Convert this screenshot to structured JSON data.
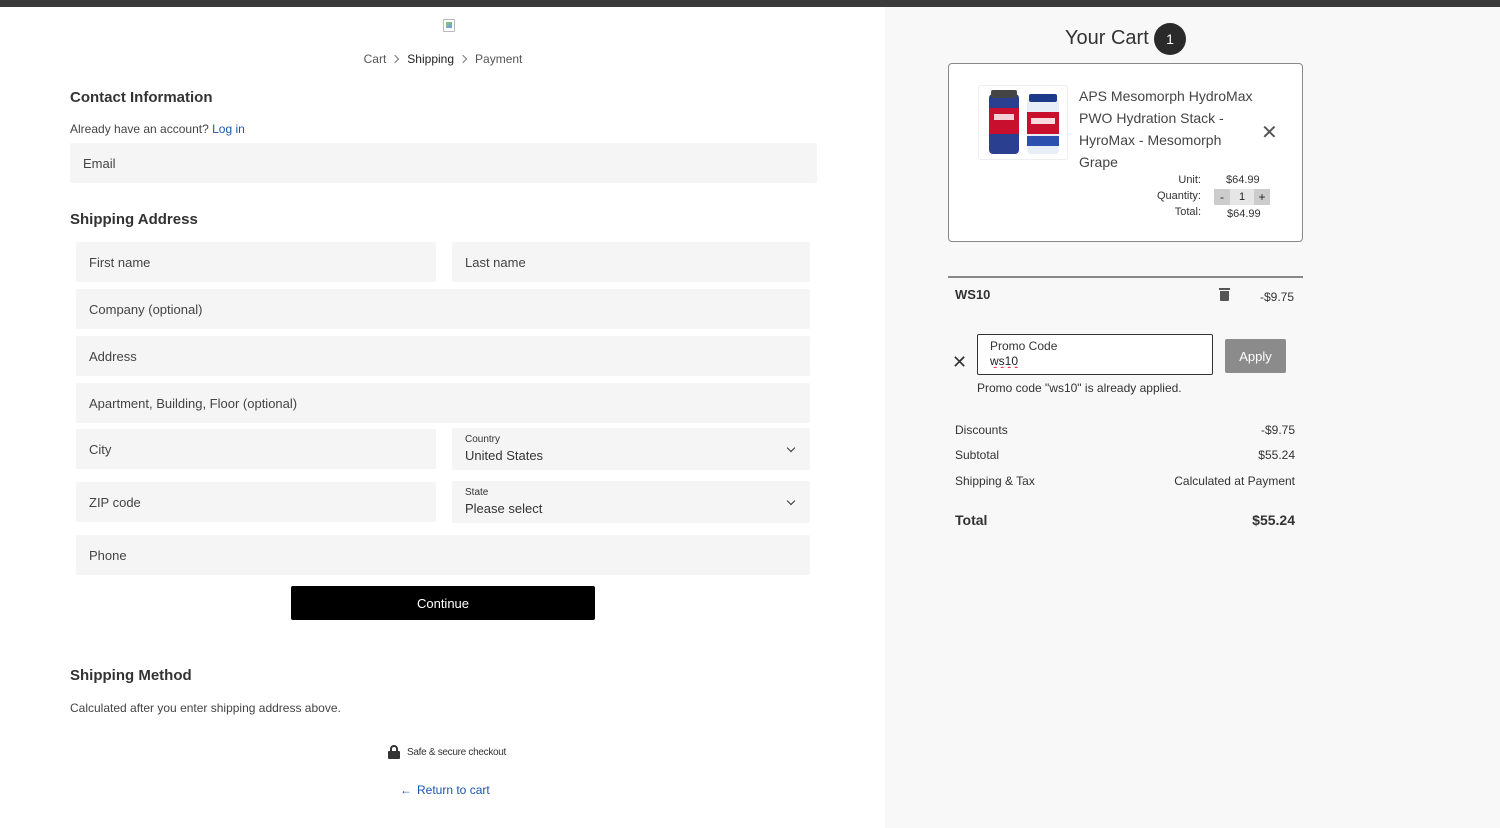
{
  "breadcrumb": {
    "cart": "Cart",
    "shipping": "Shipping",
    "payment": "Payment"
  },
  "contact": {
    "title": "Contact Information",
    "account_prompt": "Already have an account?",
    "login_link": "Log in",
    "email_placeholder": "Email"
  },
  "shipping_address": {
    "title": "Shipping Address",
    "first_name_placeholder": "First name",
    "last_name_placeholder": "Last name",
    "company_placeholder": "Company (optional)",
    "address_placeholder": "Address",
    "apartment_placeholder": "Apartment, Building, Floor (optional)",
    "city_placeholder": "City",
    "country_label": "Country",
    "country_value": "United States",
    "zip_placeholder": "ZIP code",
    "state_label": "State",
    "state_value": "Please select",
    "phone_placeholder": "Phone",
    "continue_label": "Continue"
  },
  "shipping_method": {
    "title": "Shipping Method",
    "note": "Calculated after you enter shipping address above."
  },
  "footer": {
    "secure_text": "Safe & secure checkout",
    "return_arrow": "←",
    "return_label": "Return to cart"
  },
  "cart": {
    "title": "Your Cart",
    "count": "1",
    "remove_glyph": "✕",
    "item": {
      "name": "APS Mesomorph HydroMax PWO Hydration Stack - HyroMax - Mesomorph Grape",
      "unit_label": "Unit:",
      "unit_price": "$64.99",
      "quantity_label": "Quantity:",
      "quantity": "1",
      "qty_minus": "-",
      "qty_plus": "+",
      "total_label": "Total:",
      "total": "$64.99"
    }
  },
  "promo": {
    "applied_code": "WS10",
    "applied_amount": "-$9.75",
    "clear_glyph": "✕",
    "input_label": "Promo Code",
    "input_value": "ws10",
    "apply_label": "Apply",
    "message": "Promo code \"ws10\" is already applied."
  },
  "summary": {
    "discounts_label": "Discounts",
    "discounts_value": "-$9.75",
    "subtotal_label": "Subtotal",
    "subtotal_value": "$55.24",
    "shipping_label": "Shipping & Tax",
    "shipping_value": "Calculated at Payment",
    "total_label": "Total",
    "total_value": "$55.24"
  },
  "colors": {
    "link": "#1a55b0",
    "continue_button": "#000000",
    "apply_button": "#8b8b8b",
    "right_panel_bg": "#f8f8f8"
  }
}
